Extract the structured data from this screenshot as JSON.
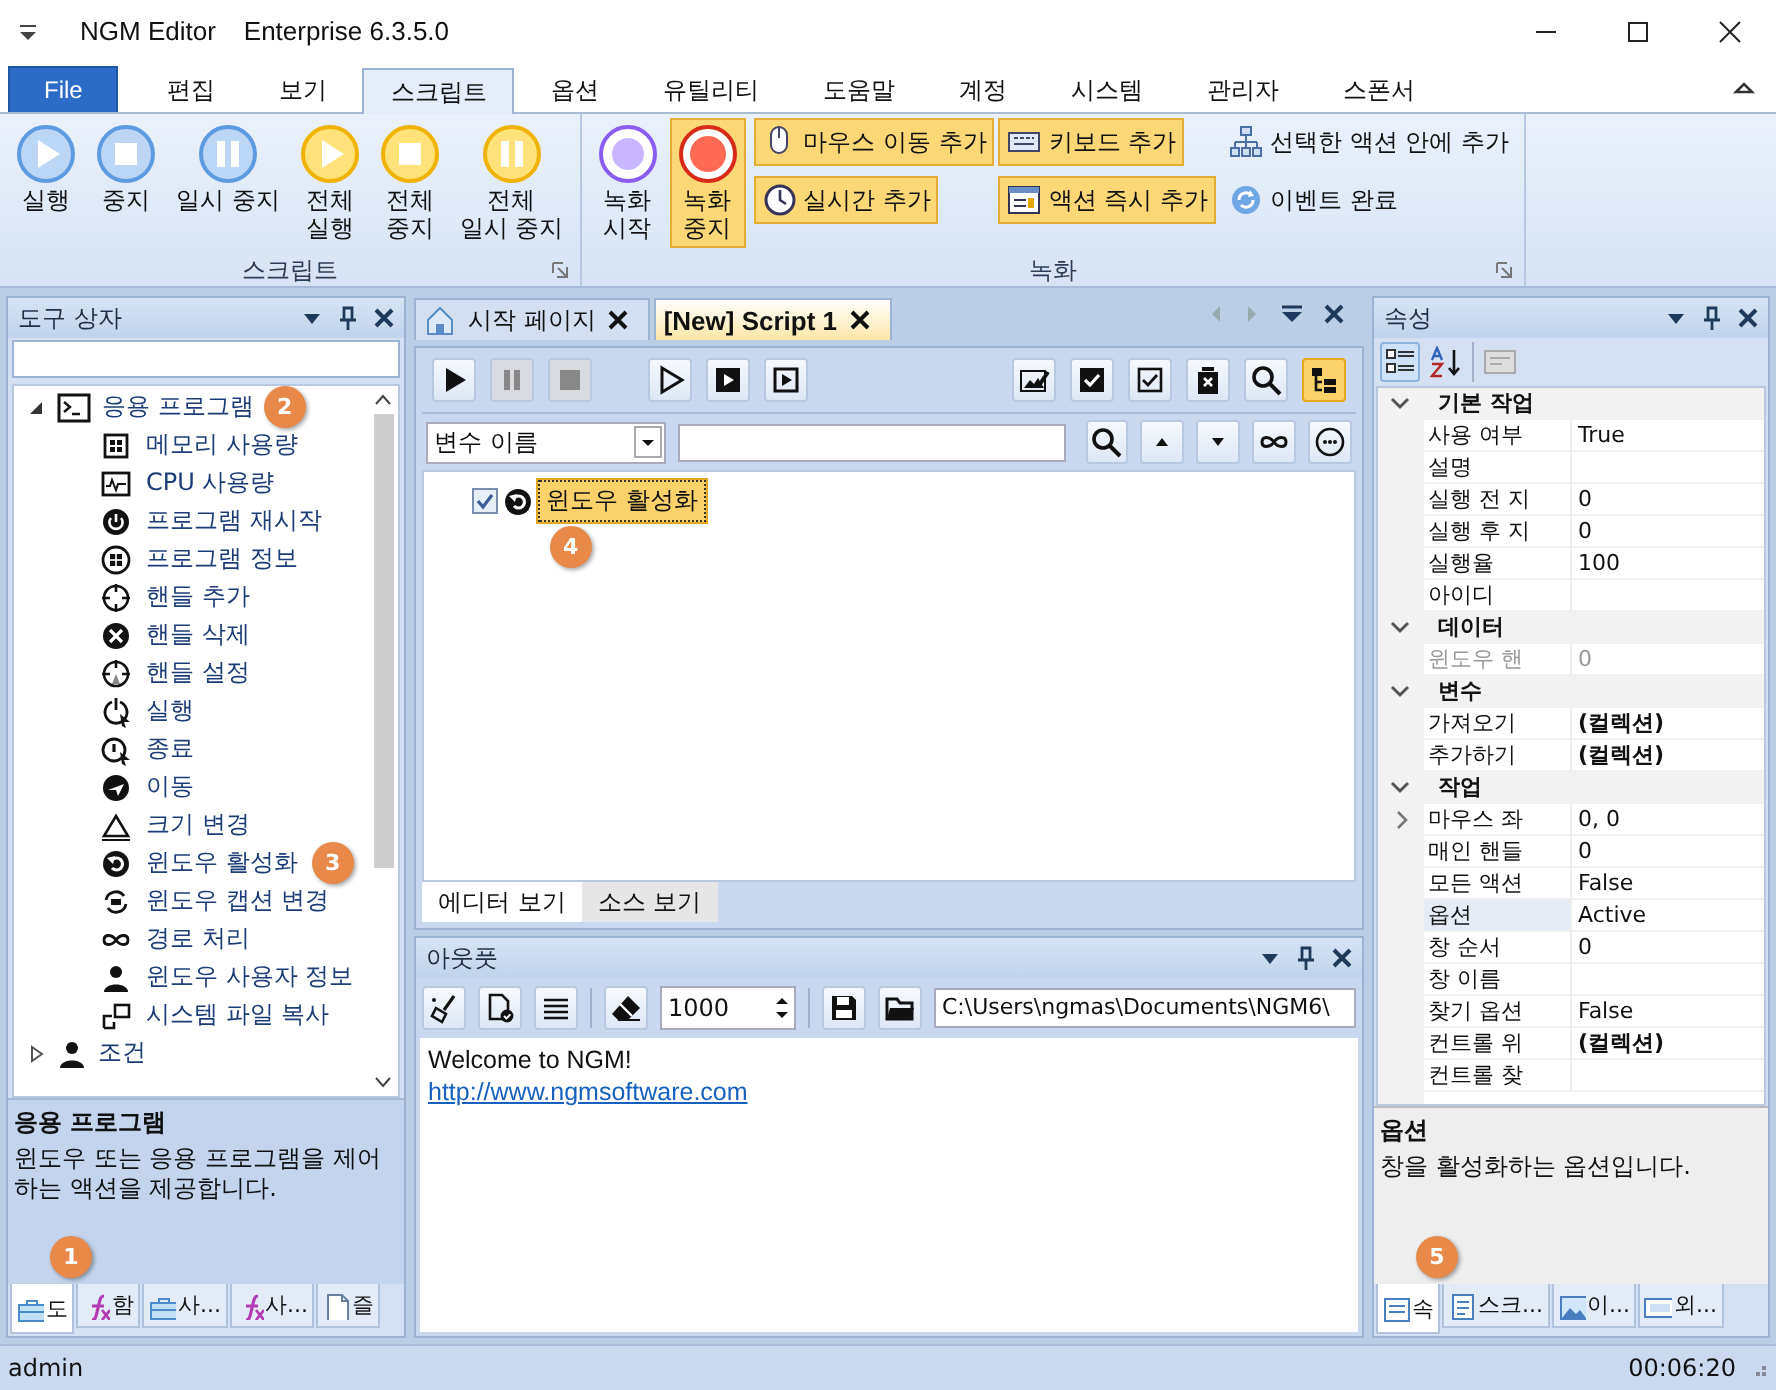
{
  "window": {
    "title": "NGM Editor",
    "edition": "Enterprise 6.3.5.0"
  },
  "ribbon": {
    "tabs": [
      {
        "label": "File",
        "kind": "file",
        "selected": false
      },
      {
        "label": "편집",
        "kind": "tab",
        "selected": false
      },
      {
        "label": "보기",
        "kind": "tab",
        "selected": false
      },
      {
        "label": "스크립트",
        "kind": "tab",
        "selected": true
      },
      {
        "label": "옵션",
        "kind": "tab",
        "selected": false
      },
      {
        "label": "유틸리티",
        "kind": "tab",
        "selected": false
      },
      {
        "label": "도움말",
        "kind": "tab",
        "selected": false
      },
      {
        "label": "계정",
        "kind": "tab",
        "selected": false
      },
      {
        "label": "시스템",
        "kind": "tab",
        "selected": false
      },
      {
        "label": "관리자",
        "kind": "tab",
        "selected": false
      },
      {
        "label": "스폰서",
        "kind": "tab",
        "selected": false
      }
    ],
    "groups": [
      {
        "title": "스크립트",
        "large": [
          {
            "label": "실행",
            "active": false
          },
          {
            "label": "중지",
            "active": false
          },
          {
            "label": "일시 중지",
            "active": false
          },
          {
            "label": "전체\n실행",
            "active": false
          },
          {
            "label": "전체\n중지",
            "active": false
          },
          {
            "label": "전체\n일시 중지",
            "active": false
          }
        ]
      },
      {
        "title": "녹화",
        "large": [
          {
            "label": "녹화\n시작",
            "active": false
          },
          {
            "label": "녹화\n중지",
            "active": true
          }
        ],
        "small": [
          {
            "label": "마우스 이동 추가",
            "active": true
          },
          {
            "label": "키보드 추가",
            "active": true
          },
          {
            "label": "선택한 액션 안에 추가",
            "active": false
          },
          {
            "label": "실시간 추가",
            "active": true
          },
          {
            "label": "액션 즉시 추가",
            "active": true
          },
          {
            "label": "이벤트 완료",
            "active": false
          }
        ]
      }
    ]
  },
  "toolbox": {
    "title": "도구 상자",
    "tree": [
      {
        "label": "응용 프로그램",
        "expanded": true,
        "badge": "2",
        "children": [
          {
            "label": "메모리 사용량"
          },
          {
            "label": "CPU 사용량"
          },
          {
            "label": "프로그램 재시작"
          },
          {
            "label": "프로그램 정보"
          },
          {
            "label": "핸들 추가"
          },
          {
            "label": "핸들 삭제"
          },
          {
            "label": "핸들 설정"
          },
          {
            "label": "실행"
          },
          {
            "label": "종료"
          },
          {
            "label": "이동"
          },
          {
            "label": "크기 변경"
          },
          {
            "label": "윈도우 활성화",
            "badge": "3"
          },
          {
            "label": "윈도우 캡션 변경"
          },
          {
            "label": "경로 처리"
          },
          {
            "label": "윈도우 사용자 정보"
          },
          {
            "label": "시스템 파일 복사"
          }
        ]
      },
      {
        "label": "조건",
        "expanded": false
      }
    ],
    "description": {
      "title": "응용 프로그램",
      "text": "윈도우 또는 응용 프로그램을 제어하는 액션을 제공합니다."
    },
    "tabs": [
      {
        "label": "도",
        "selected": true,
        "badge": "1"
      },
      {
        "label": "함",
        "selected": false
      },
      {
        "label": "사...",
        "selected": false
      },
      {
        "label": "사...",
        "selected": false
      },
      {
        "label": "즐",
        "selected": false
      }
    ]
  },
  "documents": {
    "tabs": [
      {
        "label": "시작 페이지",
        "selected": false
      },
      {
        "label": "[New] Script 1",
        "selected": true
      }
    ]
  },
  "editor": {
    "tree_view": {
      "on": true
    },
    "variable_dropdown": "변수 이름",
    "actions": [
      {
        "label": "윈도우 활성화",
        "checked": true,
        "selected": true,
        "badge": "4"
      }
    ],
    "view_tabs": [
      {
        "label": "에디터 보기",
        "selected": true
      },
      {
        "label": "소스 보기",
        "selected": false
      }
    ]
  },
  "output": {
    "title": "아웃풋",
    "limit": "1000",
    "path": "C:\\Users\\ngmas\\Documents\\NGM6\\",
    "lines": [
      "Welcome to NGM!"
    ],
    "link": "http://www.ngmsoftware.com"
  },
  "properties": {
    "title": "속성",
    "categories": [
      {
        "label": "기본 작업",
        "rows": [
          {
            "name": "사용 여부",
            "value": "True"
          },
          {
            "name": "설명"
          },
          {
            "name": "실행 전 지",
            "value": "0"
          },
          {
            "name": "실행 후 지",
            "value": "0"
          },
          {
            "name": "실행율",
            "value": "100"
          },
          {
            "name": "아이디"
          }
        ]
      },
      {
        "label": "데이터",
        "rows": [
          {
            "name": "윈도우 핸",
            "value": "0",
            "disabled": true
          }
        ]
      },
      {
        "label": "변수",
        "rows": [
          {
            "name": "가져오기",
            "value": "(컬렉션)",
            "bold": true
          },
          {
            "name": "추가하기",
            "value": "(컬렉션)",
            "bold": true
          }
        ]
      },
      {
        "label": "작업",
        "rows": [
          {
            "name": "마우스 좌",
            "value": "0, 0",
            "expanded": false
          },
          {
            "name": "매인 핸들",
            "value": "0"
          },
          {
            "name": "모든 액션",
            "value": "False"
          },
          {
            "name": "옵션",
            "value": "Active",
            "selected": true
          },
          {
            "name": "창 순서",
            "value": "0"
          },
          {
            "name": "창 이름"
          },
          {
            "name": "찾기 옵션",
            "value": "False"
          },
          {
            "name": "컨트롤 위",
            "value": "(컬렉션)",
            "bold": true
          },
          {
            "name": "컨트롤 찾"
          }
        ]
      }
    ],
    "description": {
      "title": "옵션",
      "text": "창을 활성화하는 옵션입니다."
    },
    "tabs": [
      {
        "label": "속",
        "selected": true,
        "badge": "5"
      },
      {
        "label": "스크...",
        "selected": false
      },
      {
        "label": "이...",
        "selected": false
      },
      {
        "label": "외...",
        "selected": false
      }
    ]
  },
  "status_bar": {
    "user": "admin",
    "time": "00:06:20"
  }
}
